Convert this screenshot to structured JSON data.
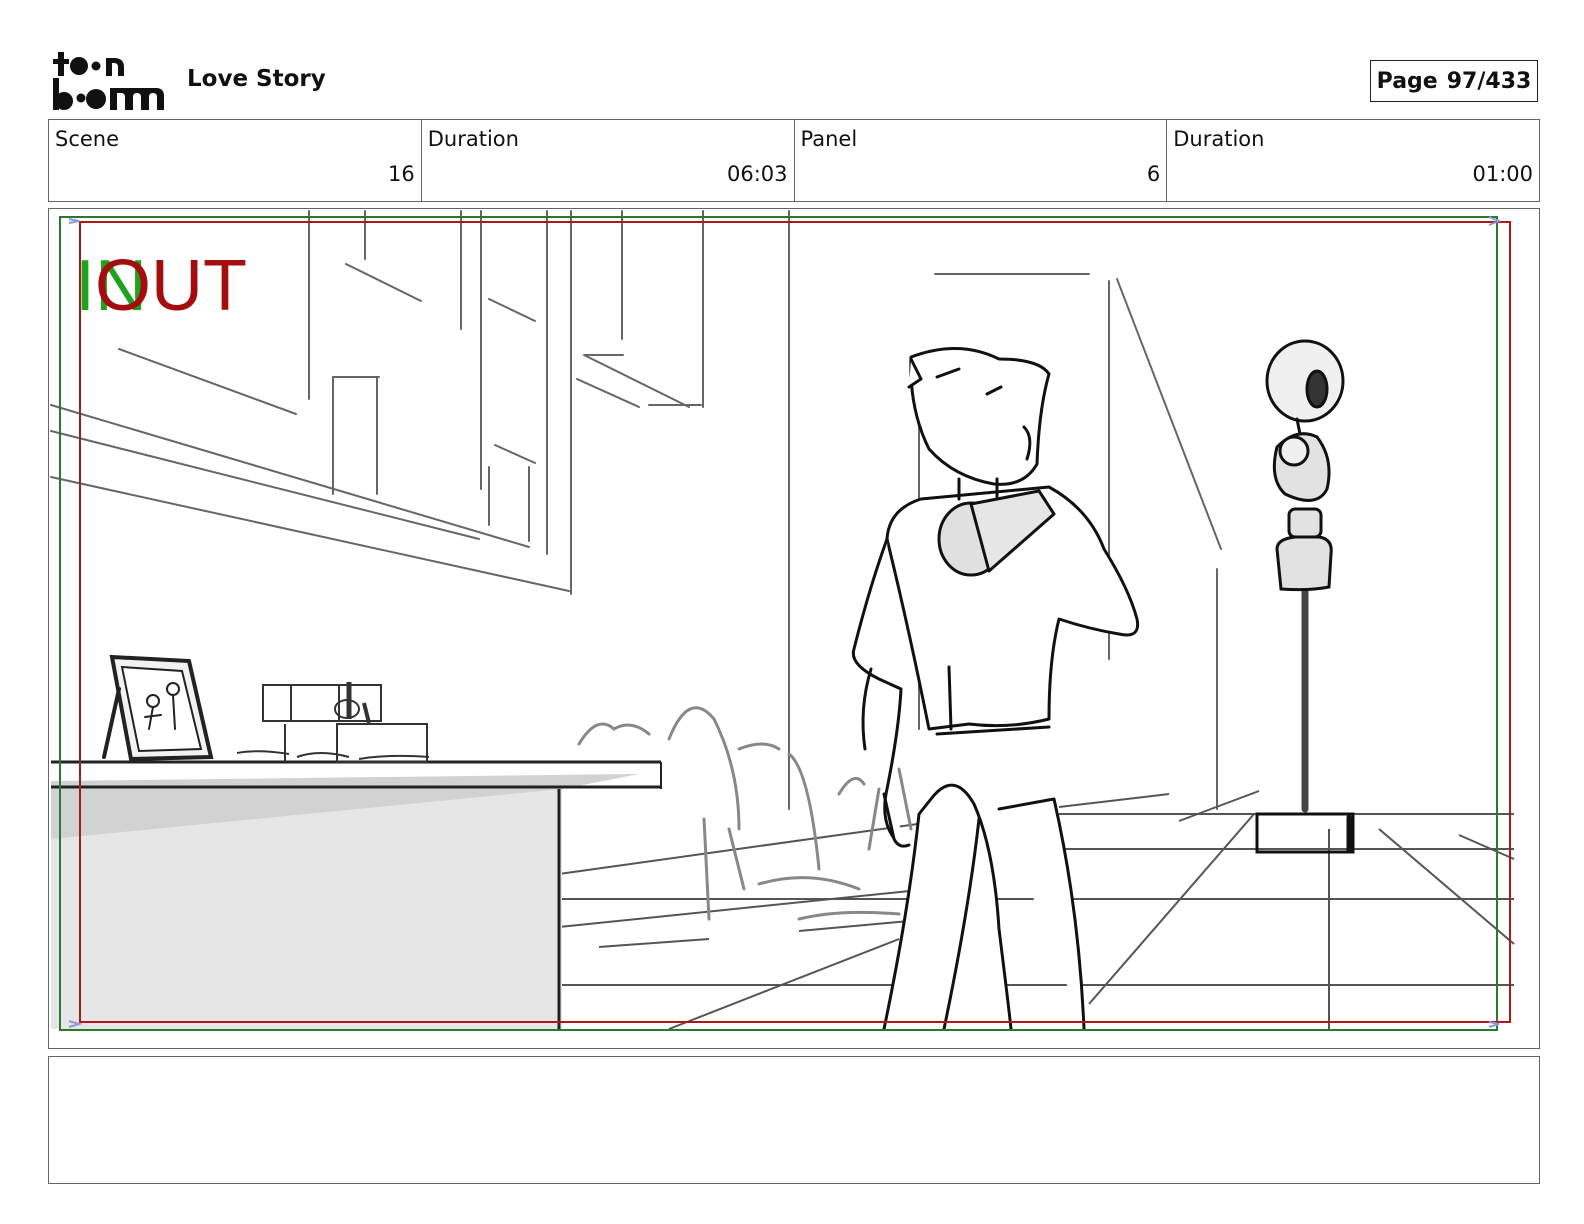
{
  "header": {
    "logo_text": "toon boom",
    "project_title": "Love Story",
    "page_label": "Page",
    "page_value": "97/433"
  },
  "info": {
    "scene_label": "Scene",
    "scene_value": "16",
    "scene_duration_label": "Duration",
    "scene_duration_value": "06:03",
    "panel_label": "Panel",
    "panel_value": "6",
    "panel_duration_label": "Duration",
    "panel_duration_value": "01:00"
  },
  "panel": {
    "in_marker": "IN",
    "out_marker": "OUT",
    "in_color": "#1fa31f",
    "out_color": "#a30d0d"
  },
  "notes": {
    "text": ""
  }
}
